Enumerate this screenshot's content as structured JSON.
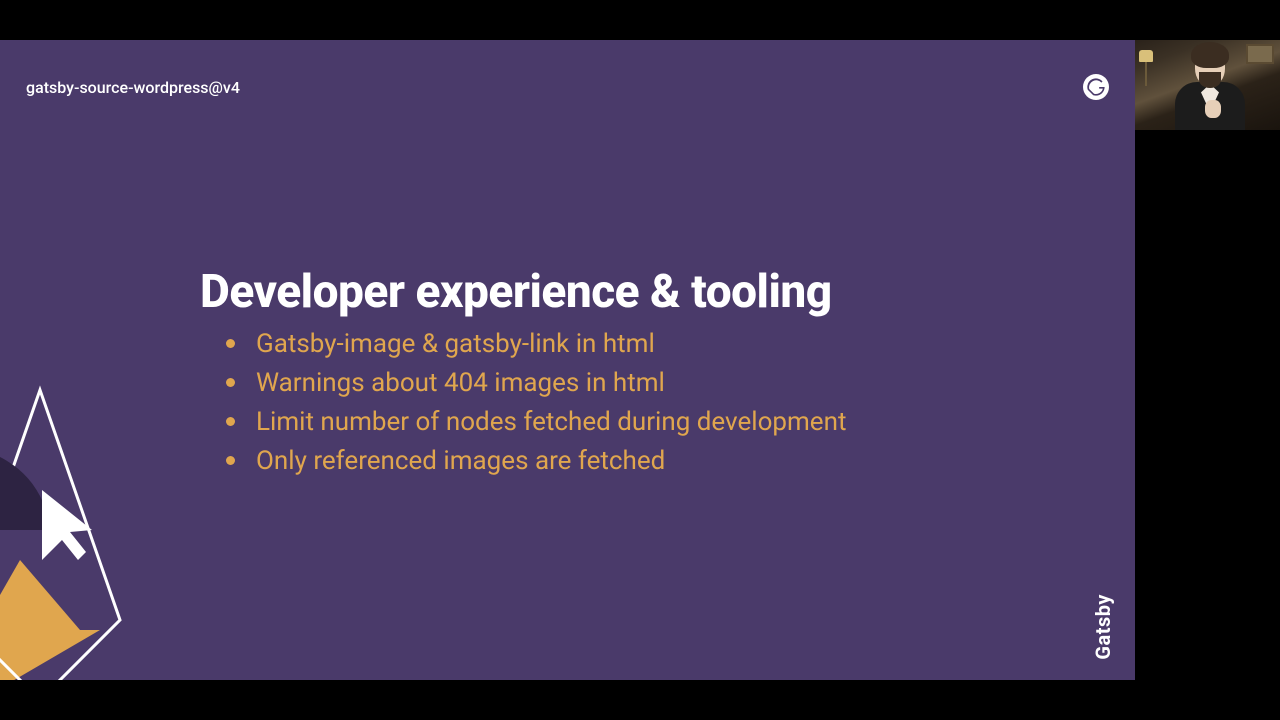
{
  "header": {
    "context": "gatsby-source-wordpress@v4"
  },
  "brand": "Gatsby",
  "slide": {
    "title": "Developer experience & tooling",
    "bullets": [
      "Gatsby-image & gatsby-link in html",
      "Warnings about 404 images in html",
      "Limit number of nodes fetched during development",
      "Only referenced images are fetched"
    ]
  },
  "icons": {
    "gatsby_logo": "gatsby-logo-icon"
  }
}
